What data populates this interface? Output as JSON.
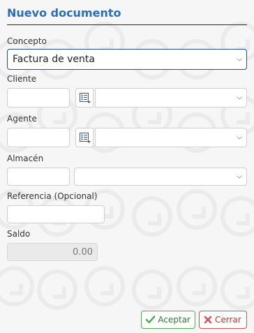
{
  "dialog": {
    "title": "Nuevo documento"
  },
  "form": {
    "concepto_label": "Concepto",
    "concepto_value": "Factura de venta",
    "cliente_label": "Cliente",
    "cliente_code": "",
    "cliente_name": "",
    "agente_label": "Agente",
    "agente_code": "",
    "agente_name": "",
    "almacen_label": "Almacén",
    "almacen_code": "",
    "almacen_name": "",
    "referencia_label": "Referencia (Opcional)",
    "referencia_value": "",
    "saldo_label": "Saldo",
    "saldo_value": "0.00"
  },
  "actions": {
    "accept_label": "Aceptar",
    "cancel_label": "Cerrar"
  },
  "colors": {
    "title": "#2a6ebb",
    "accept": "#4caf50",
    "cancel": "#d9534f"
  },
  "icons": {
    "picker": "list-picker-icon",
    "accept": "check-icon",
    "cancel": "x-icon",
    "dropdown": "chevron-down-icon"
  }
}
